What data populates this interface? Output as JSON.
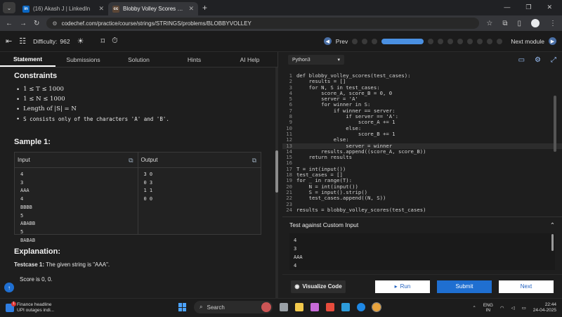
{
  "browser": {
    "tabs": [
      {
        "label": "(16) Akash J | LinkedIn",
        "favicon": "in"
      },
      {
        "label": "Blobby Volley Scores Practice P",
        "favicon": "cc"
      }
    ],
    "url": "codechef.com/practice/course/strings/STRINGS/problems/BLOBBYVOLLEY"
  },
  "site": {
    "difficulty_label": "Difficulty:",
    "difficulty_value": "962",
    "prev_label": "Prev",
    "next_module_label": "Next module"
  },
  "left": {
    "tabs": [
      "Statement",
      "Submissions",
      "Solution",
      "Hints",
      "AI Help"
    ],
    "constraints_title": "Constraints",
    "constraints": [
      "1 ≤ T ≤ 1000",
      "1 ≤ N ≤ 1000",
      "Length of |S| = N",
      "S consists only of the characters 'A' and 'B'."
    ],
    "sample_title": "Sample 1:",
    "input_header": "Input",
    "output_header": "Output",
    "input_lines": [
      "4",
      "3",
      "AAA",
      "4",
      "BBBB",
      "5",
      "ABABB",
      "5",
      "BABAB"
    ],
    "output_lines": [
      "3 0",
      "0 3",
      "1 1",
      "0 0"
    ],
    "explanation_title": "Explanation:",
    "testcase1_label": "Testcase 1:",
    "testcase1_text": "The given string is \"AAA\".",
    "score_text": "Score is 0, 0."
  },
  "editor": {
    "language": "Python3",
    "lines": [
      "def blobby_volley_scores(test_cases):",
      "    results = []",
      "    for N, S in test_cases:",
      "        score_A, score_B = 0, 0",
      "        server = 'A'",
      "        for winner in S:",
      "            if winner == server:",
      "                if server == 'A':",
      "                    score_A += 1",
      "                else:",
      "                    score_B += 1",
      "            else:",
      "                server = winner",
      "        results.append((score_A, score_B))",
      "    return results",
      "",
      "T = int(input())",
      "test_cases = []",
      "for _ in range(T):",
      "    N = int(input())",
      "    S = input().strip()",
      "    test_cases.append((N, S))",
      "",
      "results = blobby_volley_scores(test_cases)"
    ],
    "highlight_line": 13
  },
  "custom": {
    "title": "Test against Custom Input",
    "lines": [
      "4",
      "3",
      "AAA",
      "4"
    ]
  },
  "actions": {
    "visualize": "Visualize Code",
    "run": "Run",
    "submit": "Submit",
    "next": "Next"
  },
  "taskbar": {
    "weather_line1": "Finance headline",
    "weather_line2": "UPI outages indi...",
    "search": "Search",
    "lang1": "ENG",
    "lang2": "IN",
    "time": "22:44",
    "date": "24-04-2025",
    "badge": "1"
  }
}
